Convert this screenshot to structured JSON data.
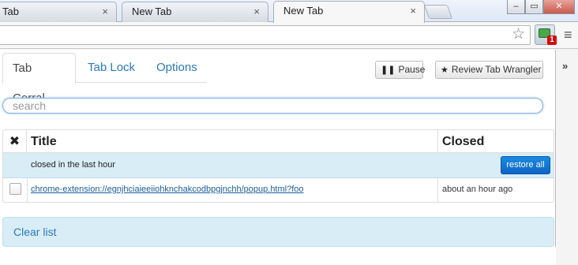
{
  "browser": {
    "tabs": [
      {
        "title": "Tab",
        "close": "×"
      },
      {
        "title": "New Tab",
        "close": "×"
      },
      {
        "title": "New Tab",
        "close": "×"
      }
    ],
    "window_controls": {
      "minimize": "–",
      "maximize": "▭",
      "close": "✕"
    },
    "extension_badge": "1",
    "side_chevron": "»"
  },
  "popup": {
    "tabs": [
      "Tab Corral",
      "Tab Lock",
      "Options"
    ],
    "pause_label": "Pause",
    "review_label": "Review Tab Wrangler",
    "search_placeholder": "search",
    "table": {
      "headers": {
        "remove": "✖",
        "title": "Title",
        "closed": "Closed"
      },
      "group": {
        "label": "closed in the last hour",
        "restore_label": "restore all"
      },
      "rows": [
        {
          "title": "chrome-extension://egnjhciaieeiiohknchakcodbpgjnchh/popup.html?foo",
          "closed": "about an hour ago"
        }
      ]
    },
    "clear_label": "Clear list"
  }
}
